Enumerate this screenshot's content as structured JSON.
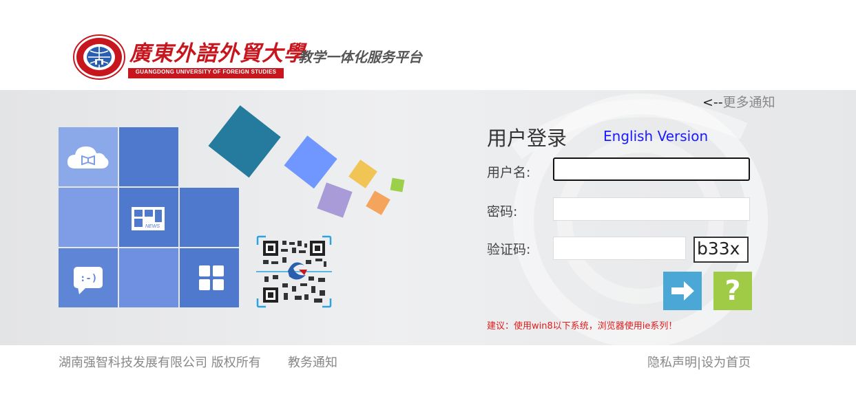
{
  "header": {
    "university_name_cn": "廣東外語外貿大學",
    "university_name_en": "GUANGDONG UNIVERSITY OF FOREIGN STUDIES",
    "platform_title": "教学一体化服务平台"
  },
  "notice_link": {
    "arrow": "<--",
    "label": "更多通知"
  },
  "tiles": [
    {
      "name": "tile-cloud-library",
      "icon": "cloud-book-icon",
      "color": "#8ba9e8"
    },
    {
      "name": "tile-blue-1",
      "icon": "",
      "color": "#4f79cc"
    },
    {
      "name": "tile-light-1",
      "icon": "",
      "color": "#7f9de6"
    },
    {
      "name": "tile-news",
      "icon": "news-icon",
      "color": "#4f79cc",
      "icon_text": "NEWS"
    },
    {
      "name": "tile-blue-2",
      "icon": "",
      "color": "#4f79cc"
    },
    {
      "name": "tile-chat",
      "icon": "chat-icon",
      "color": "#5e85d6",
      "icon_text": ":-)"
    },
    {
      "name": "tile-light-2",
      "icon": "",
      "color": "#6f8fe0"
    },
    {
      "name": "tile-apps",
      "icon": "apps-grid-icon",
      "color": "#4f79cc"
    }
  ],
  "login": {
    "title": "用户登录",
    "english_link": "English Version",
    "username_label": "用户名:",
    "password_label": "密码:",
    "captcha_label": "验证码:",
    "captcha_text": "b33x",
    "username_value": "",
    "password_value": "",
    "captcha_value": "",
    "submit_icon": "arrow-right-icon",
    "help_icon": "question-icon",
    "help_text": "?",
    "suggestion": "建议：使用win8以下系统，浏览器使用ie系列！"
  },
  "footer": {
    "copyright": "湖南强智科技发展有限公司 版权所有",
    "notice": "教务通知",
    "privacy": "隐私声明",
    "separator": "|",
    "set_home": "设为首页"
  },
  "colors": {
    "brand_red": "#c8161e",
    "tile_blue": "#4f79cc",
    "login_button": "#4aa7d6",
    "help_button": "#9fcb46",
    "warning_red": "#e11a1a",
    "link_blue": "#1a1aff"
  }
}
